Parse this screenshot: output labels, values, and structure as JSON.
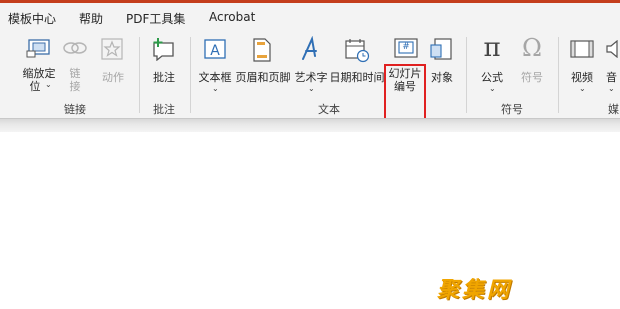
{
  "menu": {
    "template_center": "模板中心",
    "help": "帮助",
    "pdf_tools": "PDF工具集",
    "acrobat": "Acrobat"
  },
  "ribbon": {
    "zoom_line1": "缩放定",
    "zoom_line2": "位",
    "link_line1": "链",
    "link_line2": "接",
    "action": "动作",
    "comment": "批注",
    "textbox": "文本框",
    "header_footer": "页眉和页脚",
    "wordart": "艺术字",
    "datetime": "日期和时间",
    "slide_number_line1": "幻灯片",
    "slide_number_line2": "编号",
    "object": "对象",
    "formula": "公式",
    "symbol": "符号",
    "video": "视频",
    "audio": "音",
    "dropdown_arrow": "⌄",
    "slide_number_glyph": "#",
    "pi_glyph": "π",
    "omega_glyph": "Ω"
  },
  "groups": {
    "links": "链接",
    "comments": "批注",
    "text": "文本",
    "symbols": "符号",
    "media": "媒"
  },
  "watermark": "聚集网"
}
